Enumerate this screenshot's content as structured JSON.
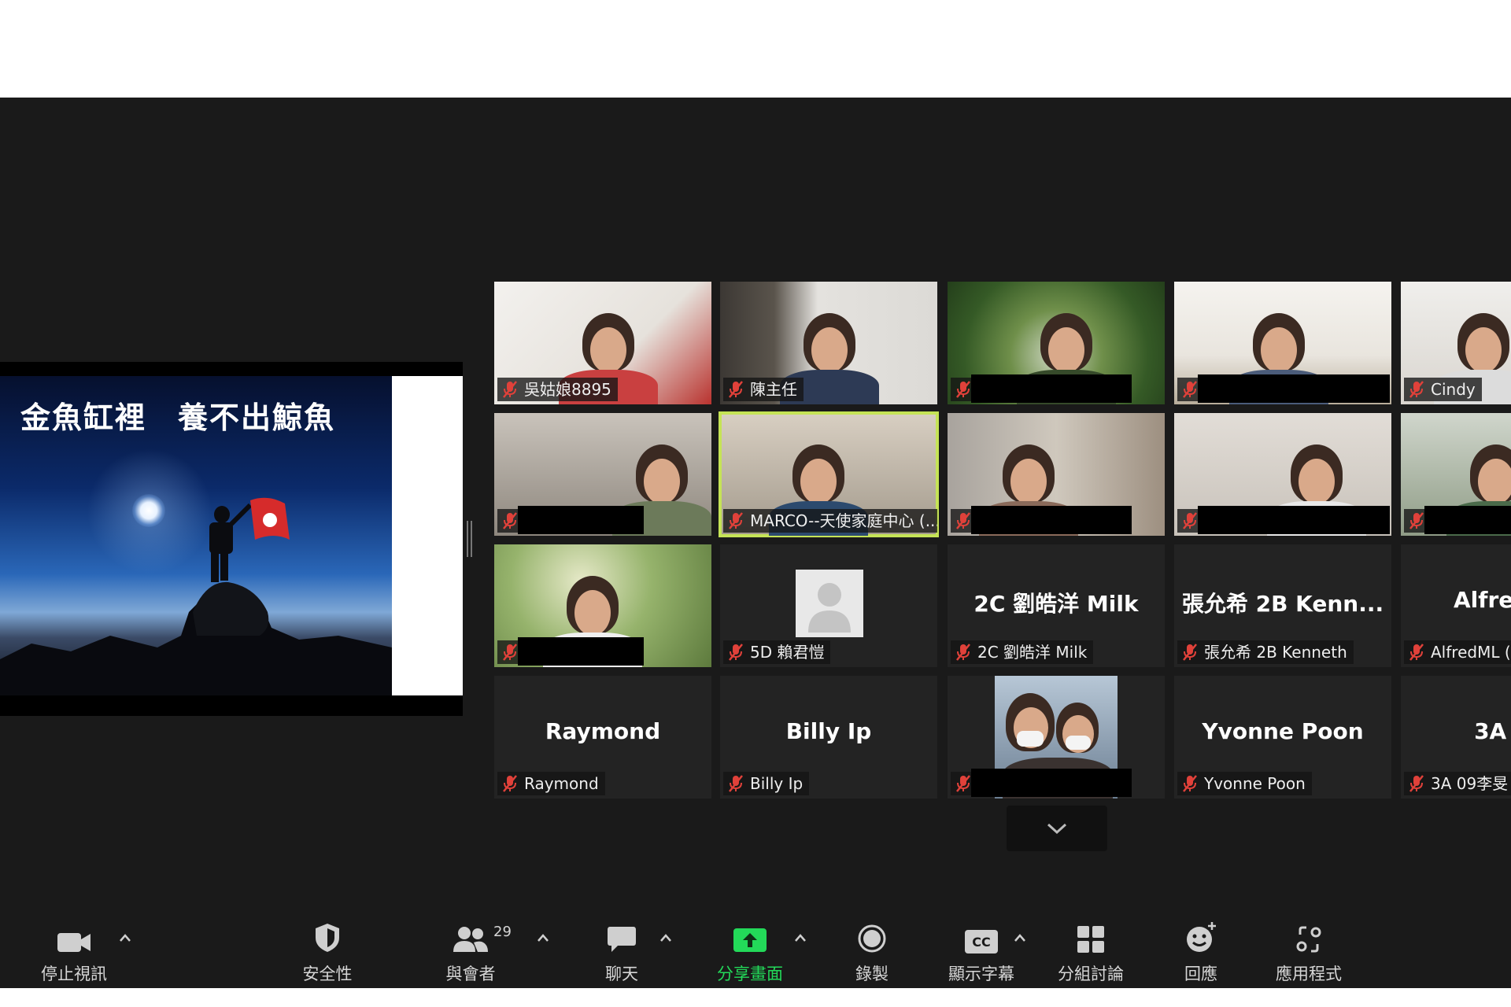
{
  "shared_screen": {
    "slide_caption": "金魚缸裡　養不出鯨魚"
  },
  "gallery": {
    "tiles": [
      {
        "label": "吳姑娘8895",
        "video": true
      },
      {
        "label": "陳主任",
        "video": true
      },
      {
        "label": "",
        "video": true,
        "redacted": true
      },
      {
        "label": "",
        "video": true,
        "redacted": true
      },
      {
        "label": "Cindy",
        "video": true
      },
      {
        "label": "",
        "video": true,
        "redacted": true
      },
      {
        "label": "MARCO--天使家庭中心 (...",
        "video": true,
        "active_speaker": true
      },
      {
        "label": "",
        "video": true,
        "redacted": true
      },
      {
        "label": "",
        "video": true,
        "redacted": true
      },
      {
        "label": "",
        "video": true,
        "redacted": true
      },
      {
        "label": "",
        "video": true,
        "redacted": true
      },
      {
        "label": "5D 賴君愷",
        "video": false,
        "avatar": true
      },
      {
        "name": "2C 劉皓洋 Milk",
        "label": "2C 劉皓洋 Milk",
        "video": false
      },
      {
        "name": "張允希 2B Kenn...",
        "label": "張允希 2B Kenneth",
        "video": false
      },
      {
        "name": "AlfredML",
        "label": "AlfredML (",
        "video": false
      },
      {
        "name": "Raymond",
        "label": "Raymond",
        "video": false
      },
      {
        "name": "Billy Ip",
        "label": "Billy Ip",
        "video": false
      },
      {
        "label": "",
        "video": true,
        "redacted": true
      },
      {
        "name": "Yvonne Poon",
        "label": "Yvonne Poon",
        "video": false
      },
      {
        "name": "3A 09",
        "label": "3A 09李旻",
        "video": false
      }
    ]
  },
  "toolbar": {
    "stop_video": "停止視訊",
    "security": "安全性",
    "participants": "與會者",
    "participants_count": "29",
    "chat": "聊天",
    "share_screen": "分享畫面",
    "record": "錄製",
    "captions": "顯示字幕",
    "breakout": "分組討論",
    "reactions": "回應",
    "apps": "應用程式",
    "cc_icon_text": "CC"
  },
  "colors": {
    "background": "#1a1a1a",
    "active_speaker_border": "#c5e356",
    "share_green": "#23d959",
    "muted_red": "#e0413a"
  }
}
